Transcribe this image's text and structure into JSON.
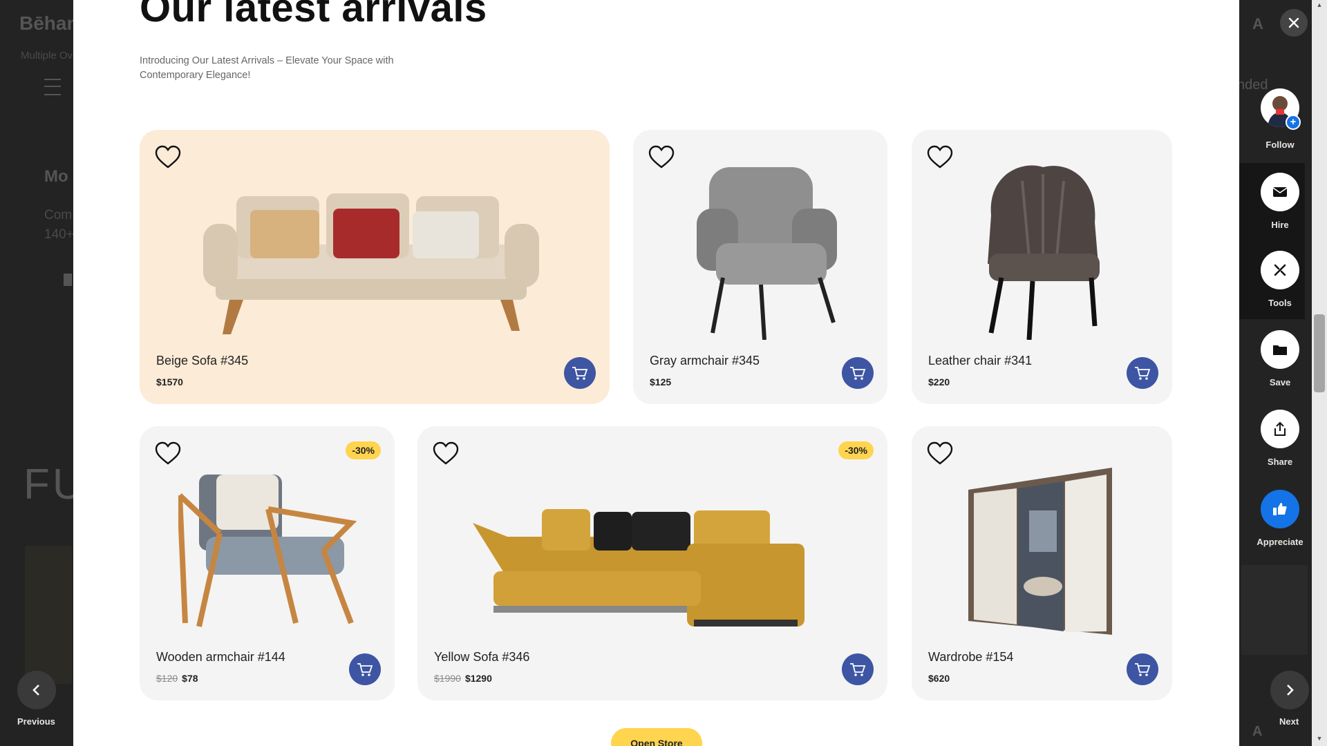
{
  "background": {
    "logo": "Bēhan",
    "subtitle": "Multiple Ov",
    "title": "Mo",
    "text_line1": "Com",
    "text_line2": "140+",
    "big_text": "FU",
    "right_text": "nded",
    "adobe_mark": "A"
  },
  "page": {
    "heading": "Our latest arrivals",
    "intro": "Introducing Our Latest Arrivals – Elevate Your Space with Contemporary Elegance!",
    "open_store": "Open Store"
  },
  "products": [
    {
      "name": "Beige Sofa #345",
      "price": "$1570"
    },
    {
      "name": "Gray armchair #345",
      "price": "$125"
    },
    {
      "name": "Leather chair #341",
      "price": "$220"
    },
    {
      "name": "Wooden armchair #144",
      "old_price": "$120",
      "price": "$78",
      "discount": "-30%"
    },
    {
      "name": "Yellow Sofa #346",
      "old_price": "$1990",
      "price": "$1290",
      "discount": "-30%"
    },
    {
      "name": "Wardrobe #154",
      "price": "$620"
    }
  ],
  "rail": {
    "follow": "Follow",
    "hire": "Hire",
    "tools": "Tools",
    "save": "Save",
    "share": "Share",
    "appreciate": "Appreciate"
  },
  "nav": {
    "previous": "Previous",
    "next": "Next"
  },
  "colors": {
    "accent_blue": "#3d55a3",
    "discount_yellow": "#ffd44e",
    "featured_card": "#fcebd6",
    "appreciate_blue": "#1473e6"
  },
  "icons": [
    "close-icon",
    "heart-icon",
    "cart-icon",
    "mail-icon",
    "tools-icon",
    "folder-icon",
    "share-icon",
    "thumbs-up-icon",
    "chevron-left-icon",
    "chevron-right-icon"
  ]
}
